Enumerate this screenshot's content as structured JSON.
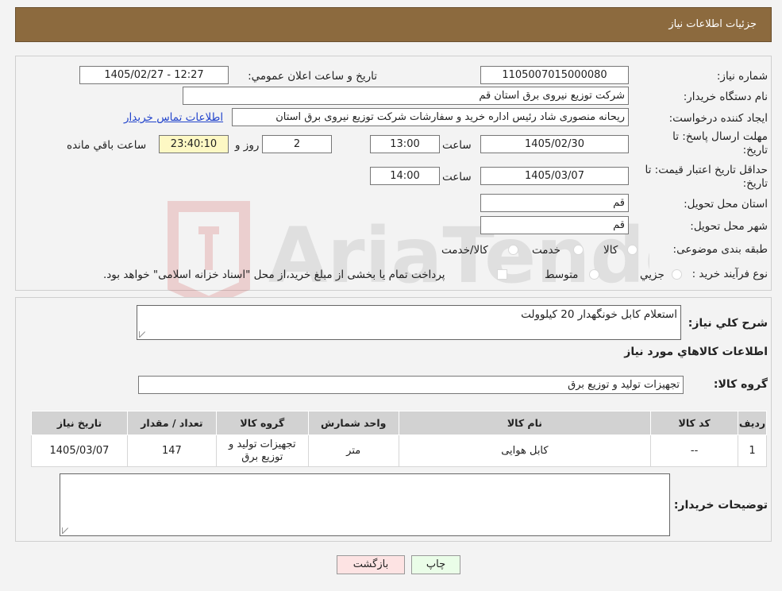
{
  "header": {
    "title": "جزئیات اطلاعات نیاز"
  },
  "form": {
    "need_number": {
      "label": "شماره نیاز:",
      "value": "1105007015000080"
    },
    "announce_datetime": {
      "label": "تاریخ و ساعت اعلان عمومي:",
      "value": "1405/02/27 - 12:27"
    },
    "buyer_org": {
      "label": "نام دستگاه خريدار:",
      "value": "شرکت توزیع نیروی برق استان قم"
    },
    "requester": {
      "label": "ايجاد کننده درخواست:",
      "value": "ریحانه منصوری شاد رئیس اداره خرید و سفارشات شرکت توزیع نیروی برق استان",
      "contact_link": "اطلاعات تماس خريدار"
    },
    "send_deadline": {
      "label": "مهلت ارسال پاسخ: تا تاريخ:",
      "date": "1405/02/30",
      "time_label": "ساعت",
      "time": "13:00",
      "days": "2",
      "days_label": "روز و",
      "remaining": "23:40:10",
      "remaining_label": "ساعت باقي مانده"
    },
    "price_validity": {
      "label": "حداقل تاريخ اعتبار قيمت: تا تاريخ:",
      "date": "1405/03/07",
      "time_label": "ساعت",
      "time": "14:00"
    },
    "delivery_province": {
      "label": "استان محل تحويل:",
      "value": "قم"
    },
    "delivery_city": {
      "label": "شهر محل تحويل:",
      "value": "قم"
    },
    "category": {
      "label": "طبقه بندی موضوعی:",
      "options": [
        "کالا",
        "خدمت",
        "کالا/خدمت"
      ]
    },
    "process_type": {
      "label": "نوع فرآيند خريد :",
      "options": [
        "جزيي",
        "متوسط"
      ],
      "note": "پرداخت تمام یا بخشی از مبلغ خرید،از محل \"اسناد خزانه اسلامی\" خواهد بود."
    }
  },
  "details": {
    "description_label": "شرح کلي نياز:",
    "description": "استعلام کابل خونگهدار 20 کیلوولت",
    "goods_info_title": "اطلاعات کالاهاي مورد نياز",
    "goods_group_label": "گروه کالا:",
    "goods_group": "تجهیزات تولید و توزیع برق",
    "table": {
      "headers": [
        "رديف",
        "کد کالا",
        "نام کالا",
        "واحد شمارش",
        "گروه کالا",
        "تعداد / مقدار",
        "تاريخ نياز"
      ],
      "rows": [
        [
          "1",
          "--",
          "کابل هوایی",
          "متر",
          "تجهیزات تولید و توزیع برق",
          "147",
          "1405/03/07"
        ]
      ]
    },
    "buyer_notes_label": "توضيحات خريدار:",
    "buyer_notes": ""
  },
  "buttons": {
    "print": "چاپ",
    "back": "بازگشت"
  },
  "watermark": {
    "text": "AriaTender.neT"
  },
  "colors": {
    "header_bg": "#8c6a3e",
    "link": "#2244cc",
    "remaining_bg": "#fdf8c4",
    "print_bg": "#eafde8",
    "back_bg": "#fde3e3"
  }
}
